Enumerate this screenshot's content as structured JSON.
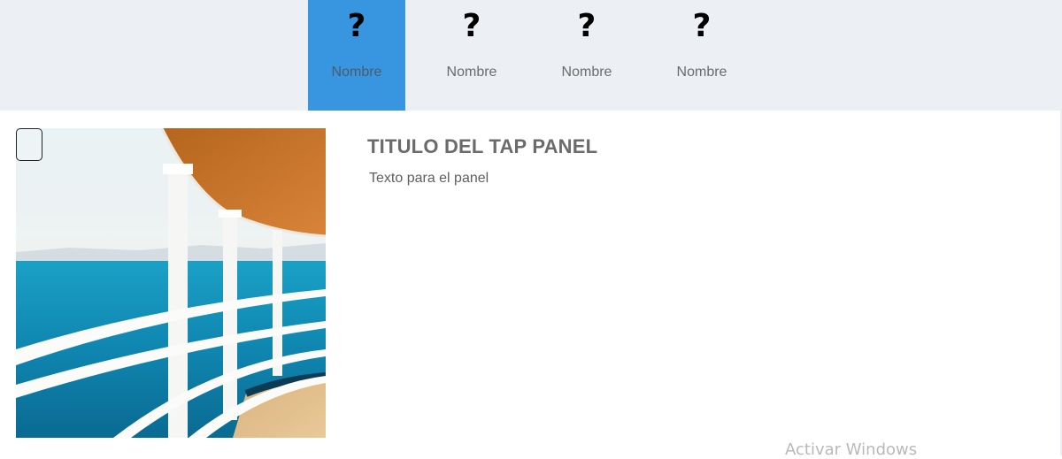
{
  "tabs": [
    {
      "icon": "question-mark-icon",
      "glyph": "?",
      "label": "Nombre",
      "active": true
    },
    {
      "icon": "question-mark-icon",
      "glyph": "?",
      "label": "Nombre",
      "active": false
    },
    {
      "icon": "question-mark-icon",
      "glyph": "?",
      "label": "Nombre",
      "active": false
    },
    {
      "icon": "question-mark-icon",
      "glyph": "?",
      "label": "Nombre",
      "active": false
    }
  ],
  "panel": {
    "title": "TITULO DEL TAP PANEL",
    "text": "Texto para el panel",
    "image_subject": "ship deck railing overlooking the sea"
  },
  "watermark": "Activar Windows",
  "colors": {
    "tabbar_bg": "#eceff4",
    "active_tab_bg": "#3896e0",
    "label_text": "#6b6b6b"
  }
}
